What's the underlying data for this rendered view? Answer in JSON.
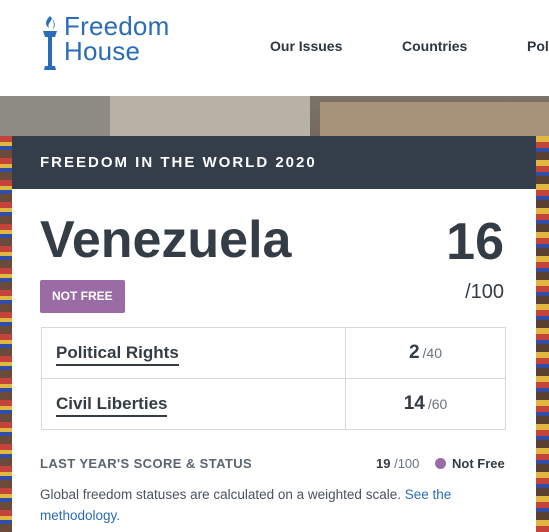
{
  "header": {
    "logo": {
      "line1": "Freedom",
      "line2": "House"
    },
    "nav": [
      {
        "label": "Our Issues"
      },
      {
        "label": "Countries"
      },
      {
        "label": "Pol"
      }
    ]
  },
  "card": {
    "title": "FREEDOM IN THE WORLD 2020",
    "country": "Venezuela",
    "total_score": "16",
    "total_max": "/100",
    "status": "NOT FREE",
    "categories": [
      {
        "label": "Political Rights",
        "score": "2",
        "max": "/40"
      },
      {
        "label": "Civil Liberties",
        "score": "14",
        "max": "/60"
      }
    ],
    "last_year": {
      "label": "LAST YEAR'S SCORE & STATUS",
      "score": "19",
      "max": "/100",
      "status": "Not Free"
    },
    "note": {
      "text": "Global freedom statuses are calculated on a weighted scale. ",
      "link": "See the methodology."
    }
  },
  "colors": {
    "brand_blue": "#2b6cb8",
    "header_dark": "#343e4a",
    "not_free_purple": "#9b6ba6"
  }
}
